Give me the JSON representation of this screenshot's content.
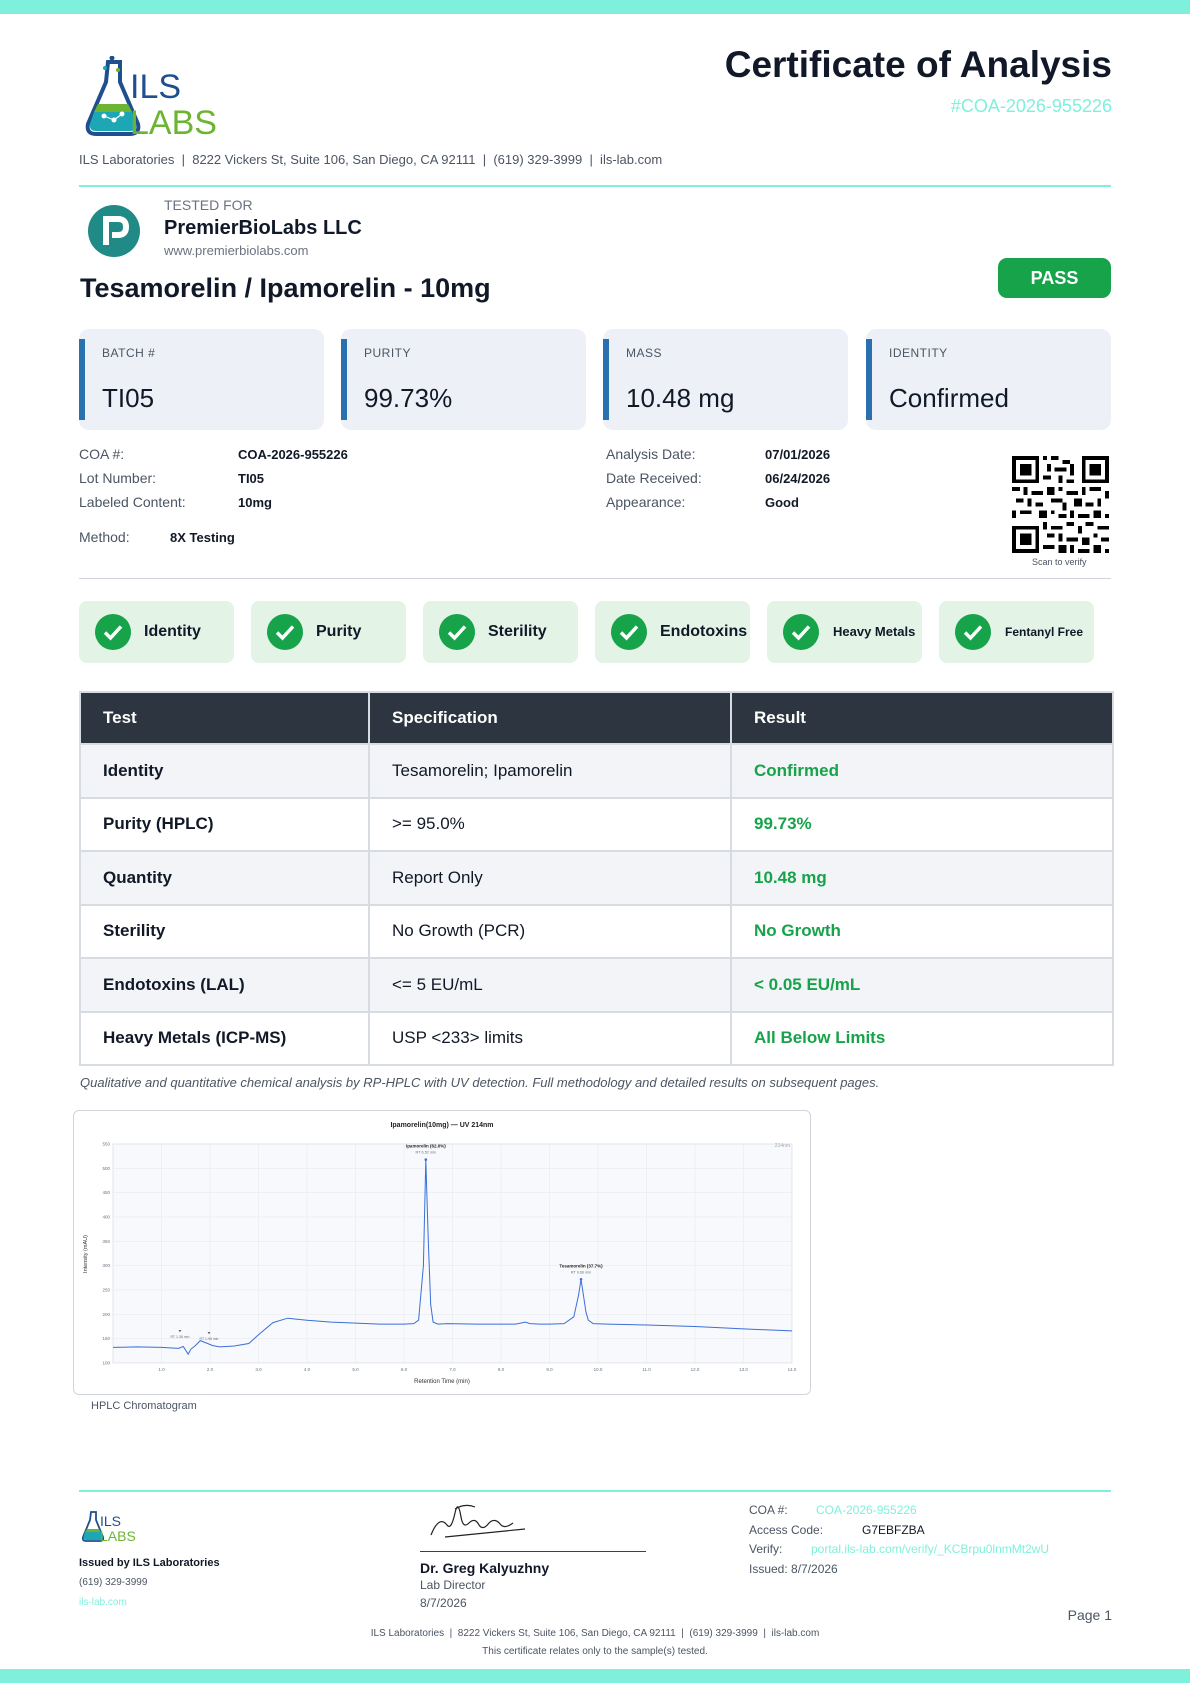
{
  "header": {
    "logo_text_top": "ILS",
    "logo_text_bottom": "LABS",
    "title": "Certificate of Analysis",
    "coa_id": "#COA-2026-955226",
    "address": "ILS Laboratories  |  8222 Vickers St, Suite 106, San Diego, CA 92111  |  (619) 329-3999  |  ils-lab.com"
  },
  "client": {
    "tested_for_label": "TESTED FOR",
    "name": "PremierBioLabs LLC",
    "website": "www.premierbiolabs.com"
  },
  "product": {
    "name": "Tesamorelin / Ipamorelin - 10mg",
    "status": "PASS"
  },
  "stats": [
    {
      "label": "BATCH #",
      "value": "TI05"
    },
    {
      "label": "PURITY",
      "value": "99.73%"
    },
    {
      "label": "MASS",
      "value": "10.48 mg"
    },
    {
      "label": "IDENTITY",
      "value": "Confirmed"
    }
  ],
  "details": {
    "coa_label": "COA #:",
    "coa_value": "COA-2026-955226",
    "lot_label": "Lot Number:",
    "lot_value": "TI05",
    "labeled_label": "Labeled Content:",
    "labeled_value": "10mg",
    "method_label": "Method:",
    "method_value": "8X Testing",
    "analysis_label": "Analysis Date:",
    "analysis_value": "07/01/2026",
    "received_label": "Date Received:",
    "received_value": "06/24/2026",
    "appearance_label": "Appearance:",
    "appearance_value": "Good",
    "scan_label": "Scan to verify"
  },
  "badges": [
    "Identity",
    "Purity",
    "Sterility",
    "Endotoxins",
    "Heavy Metals",
    "Fentanyl Free"
  ],
  "table": {
    "headers": [
      "Test",
      "Specification",
      "Result"
    ],
    "rows": [
      {
        "test": "Identity",
        "spec": "Tesamorelin; Ipamorelin",
        "result": "Confirmed"
      },
      {
        "test": "Purity (HPLC)",
        "spec": ">= 95.0%",
        "result": "99.73%"
      },
      {
        "test": "Quantity",
        "spec": "Report Only",
        "result": "10.48 mg"
      },
      {
        "test": "Sterility",
        "spec": "No Growth (PCR)",
        "result": "No Growth"
      },
      {
        "test": "Endotoxins (LAL)",
        "spec": "<= 5 EU/mL",
        "result": "< 0.05 EU/mL"
      },
      {
        "test": "Heavy Metals (ICP-MS)",
        "spec": "USP <233> limits",
        "result": "All Below Limits"
      }
    ]
  },
  "note": "Qualitative and quantitative chemical analysis by RP-HPLC with UV detection. Full methodology and detailed results on subsequent pages.",
  "chart_data": {
    "type": "line",
    "title": "Ipamorelin(10mg) — UV 214nm",
    "xlabel": "Retention Time (min)",
    "ylabel": "Intensity (mAU)",
    "corner_label": "214nm",
    "caption": "HPLC Chromatogram",
    "xlim": [
      0,
      14
    ],
    "ylim": [
      100,
      550
    ],
    "xticks": [
      "1.0",
      "2.0",
      "3.0",
      "4.0",
      "5.0",
      "6.0",
      "7.0",
      "8.0",
      "9.0",
      "10.0",
      "11.0",
      "12.0",
      "13.0",
      "14.0"
    ],
    "yticks": [
      "100",
      "150",
      "200",
      "250",
      "300",
      "350",
      "400",
      "450",
      "500",
      "550"
    ],
    "series": [
      {
        "color": "#3b6fd8",
        "x": [
          0,
          0.5,
          1.0,
          1.35,
          1.45,
          1.55,
          1.6,
          1.7,
          1.8,
          1.95,
          2.05,
          2.2,
          2.5,
          2.8,
          3.0,
          3.3,
          3.6,
          4.0,
          4.5,
          5.0,
          5.5,
          6.0,
          6.2,
          6.3,
          6.4,
          6.45,
          6.5,
          6.55,
          6.6,
          6.7,
          6.9,
          7.5,
          8.0,
          8.3,
          8.5,
          8.6,
          8.8,
          9.0,
          9.3,
          9.5,
          9.6,
          9.65,
          9.7,
          9.75,
          9.8,
          9.9,
          10.2,
          11,
          12,
          13,
          14
        ],
        "y": [
          132,
          133,
          132,
          130,
          134,
          118,
          128,
          136,
          146,
          140,
          136,
          133,
          135,
          140,
          158,
          183,
          192,
          188,
          184,
          182,
          180,
          180,
          181,
          188,
          300,
          518,
          350,
          220,
          184,
          180,
          181,
          180,
          180,
          180,
          184,
          181,
          180,
          180,
          181,
          195,
          240,
          272,
          240,
          205,
          188,
          181,
          180,
          178,
          175,
          170,
          166
        ]
      }
    ],
    "peaks": [
      {
        "label": "Ipamorelin (62.0%)",
        "rt_label": "RT 6.52 min",
        "x": 6.45,
        "y": 518
      },
      {
        "label": "Tesamorelin (37.7%)",
        "rt_label": "RT 9.66 min",
        "x": 9.65,
        "y": 272
      }
    ],
    "minor_labels": [
      {
        "label": "RT 1.38 min",
        "x": 1.38,
        "y": 147
      },
      {
        "label": "RT 1.98 min",
        "x": 1.98,
        "y": 143
      }
    ]
  },
  "footer": {
    "logo_text_top": "ILS",
    "logo_text_bottom": "LABS",
    "issued_by": "Issued by ILS Laboratories",
    "phone": "(619) 329-3999",
    "website": "ils-lab.com",
    "signer_name": "Dr. Greg Kalyuzhny",
    "signer_role": "Lab Director",
    "signer_date": "8/7/2026",
    "coa_label": "COA #:",
    "coa_value": "COA-2026-955226",
    "access_label": "Access Code:",
    "access_value": "G7EBFZBA",
    "verify_label": "Verify:",
    "verify_value": "portal.ils-lab.com/verify/_KCBrpu0lnmMt2wU",
    "issued": "Issued: 8/7/2026",
    "page": "Page 1",
    "address": "ILS Laboratories  |  8222 Vickers St, Suite 106, San Diego, CA 92111  |  (619) 329-3999  |  ils-lab.com",
    "disclaimer": "This certificate relates only to the sample(s) tested."
  },
  "colors": {
    "accent_teal": "#7ef0dc",
    "pass_green": "#16a34a",
    "card_bar_blue": "#2a6fae",
    "table_header": "#2d3640",
    "logo_blue": "#1f4f8f",
    "logo_green": "#6bb532"
  }
}
